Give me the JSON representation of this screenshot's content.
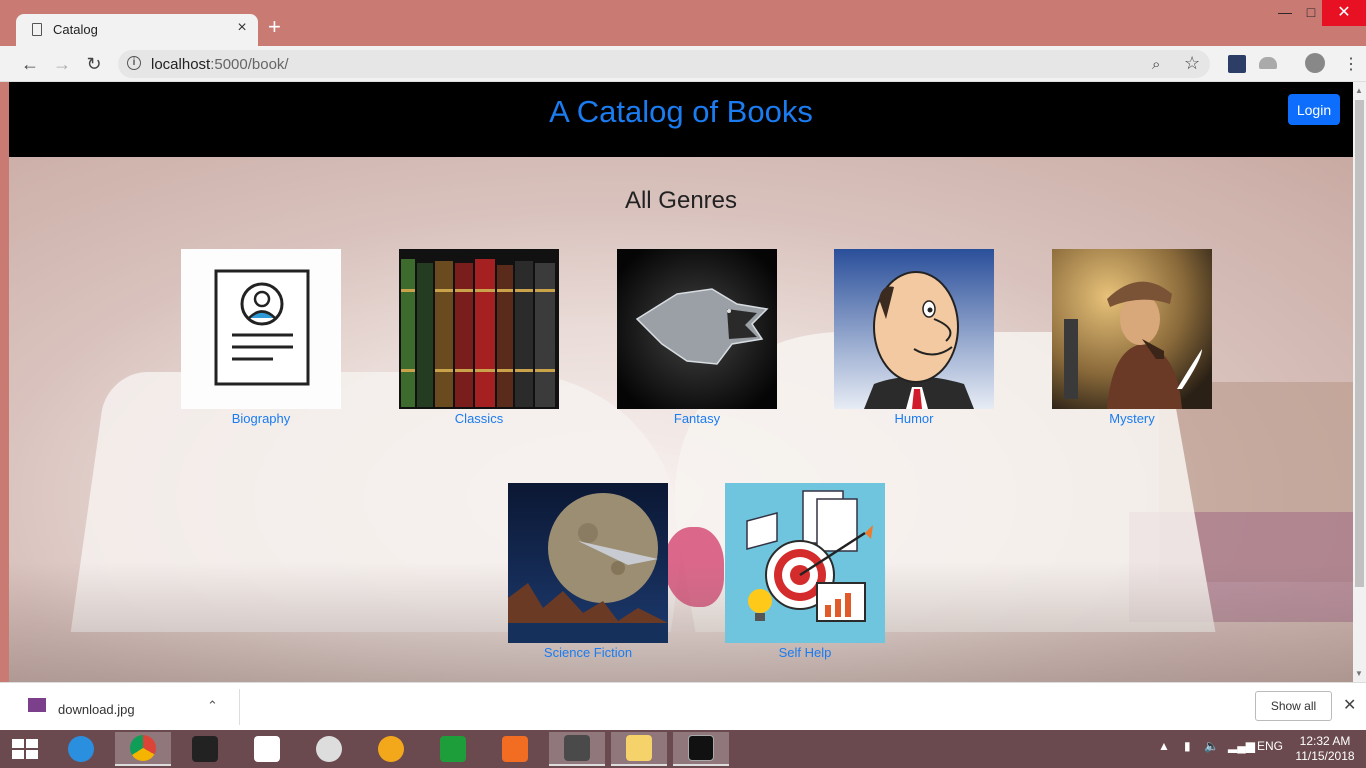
{
  "browser": {
    "tab_title": "Catalog",
    "tab_close": "×",
    "new_tab": "+",
    "url_host": "localhost",
    "url_rest": ":5000/book/",
    "window_controls": {
      "minimize": "—",
      "maximize": "□",
      "close": "✕"
    }
  },
  "page": {
    "site_title": "A Catalog of Books",
    "login_label": "Login",
    "section_title": "All Genres",
    "genres": [
      {
        "name": "Biography",
        "icon": "profile-document-icon"
      },
      {
        "name": "Classics",
        "icon": "bookshelf-image"
      },
      {
        "name": "Fantasy",
        "icon": "wolf-sigil-image"
      },
      {
        "name": "Humor",
        "icon": "cartoon-man-image"
      },
      {
        "name": "Mystery",
        "icon": "detective-image"
      },
      {
        "name": "Science Fiction",
        "icon": "spaceship-planet-image"
      },
      {
        "name": "Self Help",
        "icon": "target-goals-image"
      }
    ]
  },
  "download_bar": {
    "file_name": "download.jpg",
    "show_all_label": "Show all"
  },
  "taskbar": {
    "time": "12:32 AM",
    "date": "11/15/2018",
    "language": "ENG"
  },
  "colors": {
    "accent": "#1a7cf0",
    "header_bg": "#000000",
    "login_bg": "#0d6efd",
    "browser_frame": "#c97a73"
  }
}
